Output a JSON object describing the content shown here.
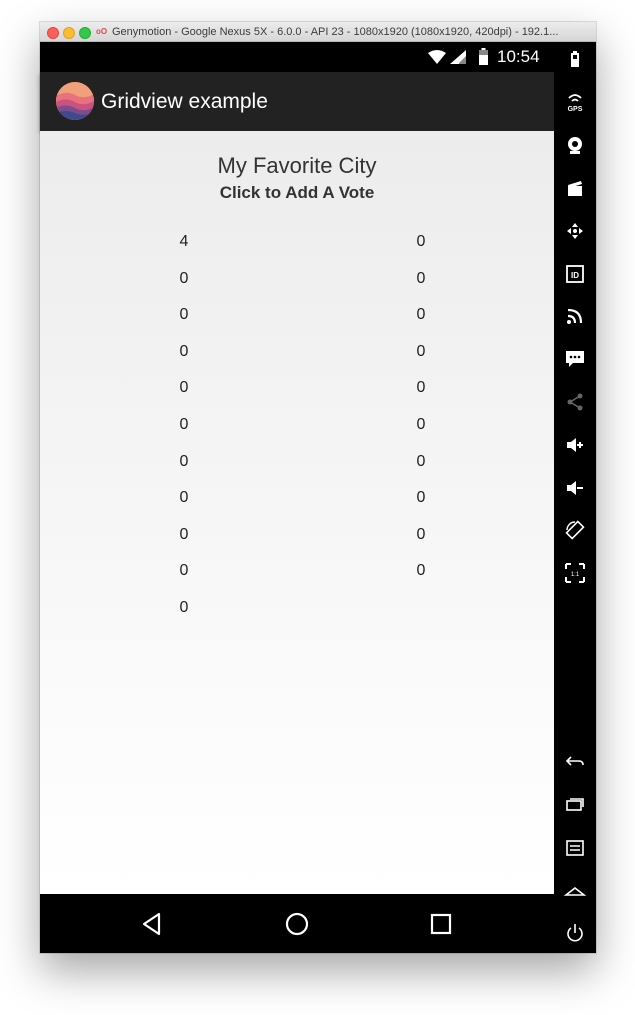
{
  "window": {
    "title": "Genymotion - Google Nexus 5X - 6.0.0 - API 23 - 1080x1920 (1080x1920, 420dpi) - 192.1..."
  },
  "status_bar": {
    "time": "10:54"
  },
  "action_bar": {
    "title": "Gridview example"
  },
  "header": {
    "title": "My Favorite City",
    "subtitle": "Click to Add A Vote"
  },
  "grid": {
    "columns": 2,
    "votes": [
      "4",
      "0",
      "0",
      "0",
      "0",
      "0",
      "0",
      "0",
      "0",
      "0",
      "0",
      "0",
      "0",
      "0",
      "0",
      "0",
      "0",
      "0",
      "0",
      "0",
      "0"
    ]
  },
  "sidebar_icons": [
    "battery-icon",
    "gps-icon",
    "webcam-icon",
    "clapperboard-icon",
    "dpad-icon",
    "id-icon",
    "cast-icon",
    "sms-icon",
    "share-icon",
    "volume-up-icon",
    "volume-down-icon",
    "rotate-icon",
    "scale-icon",
    "back-icon",
    "recent-apps-icon",
    "menu-icon",
    "home-icon",
    "power-icon"
  ],
  "nav_bar_icons": [
    "back-triangle-icon",
    "home-circle-icon",
    "recents-square-icon"
  ],
  "colors": {
    "action_bar": "#222222",
    "content_bg": "#ececec",
    "text": "#222222"
  }
}
